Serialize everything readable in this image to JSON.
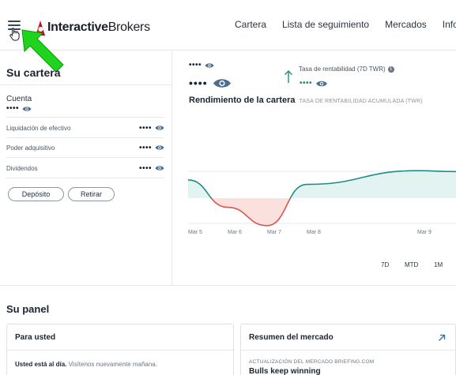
{
  "header": {
    "logo": {
      "bold": "Interactive",
      "light": "Brokers"
    },
    "nav": [
      "Cartera",
      "Lista de seguimiento",
      "Mercados",
      "Inform"
    ]
  },
  "portfolio": {
    "title": "Su cartera",
    "account_label": "Cuenta",
    "account_value": "••••",
    "metrics": [
      {
        "label": "Liquidación de efectivo",
        "value": "••••"
      },
      {
        "label": "Poder adquisitivo",
        "value": "••••"
      },
      {
        "label": "Dividendos",
        "value": "••••"
      }
    ],
    "buttons": {
      "deposit": "Depósito",
      "withdraw": "Retirar"
    }
  },
  "performance": {
    "small_value": "••••",
    "big_value": "••••",
    "twr_label": "Tasa de rentabilidad (7D TWR)",
    "twr_info": "i",
    "twr_value": "••••",
    "title": "Rendimiento de la cartera",
    "subtitle": "TASA DE RENTABILIDAD ACUMULADA (TWR)",
    "ranges": [
      "7D",
      "MTD",
      "1M"
    ]
  },
  "chart_data": {
    "type": "area",
    "x": [
      "Mar 5",
      "Mar 6",
      "Mar 7",
      "Mar 8",
      "Mar 9"
    ],
    "y_shape": [
      0.4,
      -0.2,
      -0.6,
      0.3,
      0.6
    ],
    "baseline": 0,
    "colors": {
      "positive": "#1f8c86",
      "negative": "#d9534f",
      "positive_fill": "#e3f3f1",
      "negative_fill": "#fbe1de"
    },
    "grid": true
  },
  "panel": {
    "title": "Su panel",
    "for_you": {
      "title": "Para usted",
      "bold_text": "Usted está al día.",
      "text": "Visítenos nuevamente mañana."
    },
    "market": {
      "title": "Resumen del mercado",
      "kicker": "ACTUALIZACIÓN DEL MERCADO BRIEFING.COM",
      "headline": "Bulls keep winning"
    }
  },
  "icons": {
    "menu": "hamburger-icon",
    "eye": "eye-icon",
    "up_arrow": "arrow-up-icon",
    "external": "arrow-up-right-icon",
    "annotation": "green-arrow-overlay"
  }
}
